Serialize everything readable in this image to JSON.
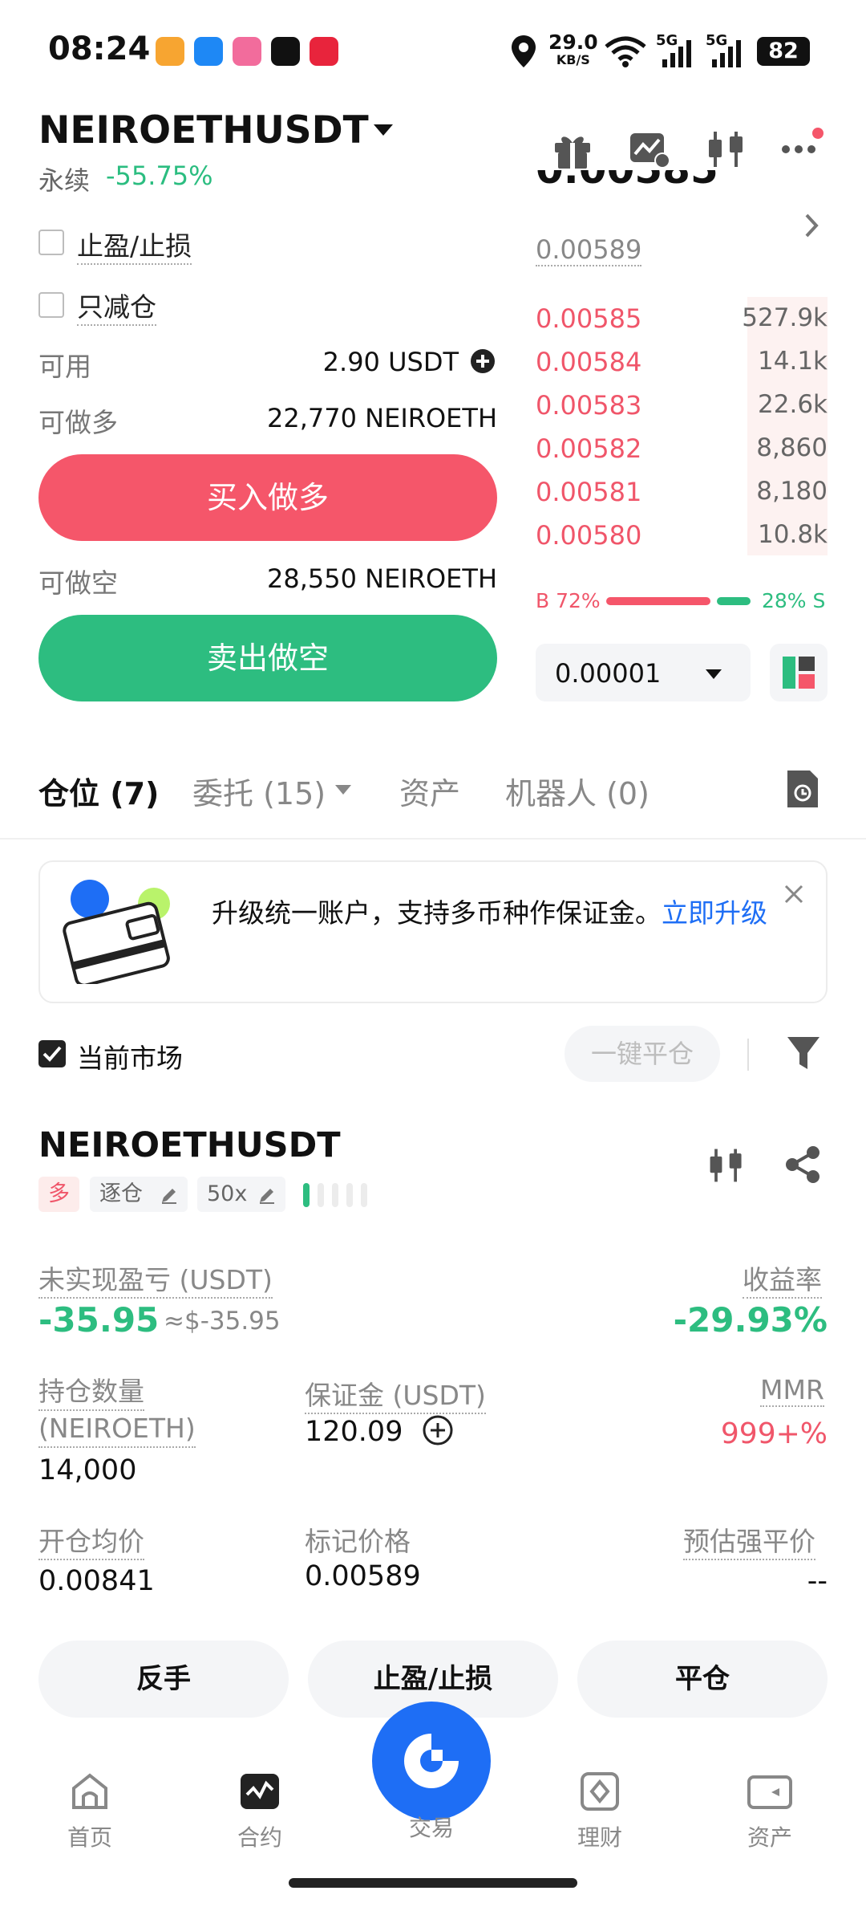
{
  "status_bar": {
    "time": "08:24",
    "net_speed": "29.0",
    "net_unit": "KB/S",
    "signal1": "5G",
    "signal2": "5G",
    "battery": "82"
  },
  "header": {
    "pair": "NEIROETHUSDT",
    "contract_type": "永续",
    "change": "-55.75%",
    "icons": [
      "gift-icon",
      "chart-edit-icon",
      "candlestick-icon",
      "more-icon"
    ]
  },
  "order_form": {
    "tp_sl_label": "止盈/止损",
    "reduce_only_label": "只减仓",
    "available_label": "可用",
    "available_value": "2.90 USDT",
    "long_label": "可做多",
    "long_value": "22,770 NEIROETH",
    "buy_button": "买入做多",
    "short_label": "可做空",
    "short_value": "28,550 NEIROETH",
    "sell_button": "卖出做空"
  },
  "orderbook": {
    "last_price_partial": "0.00585",
    "mark_price": "0.00589",
    "asks": [
      {
        "price": "0.00585",
        "qty": "527.9k"
      },
      {
        "price": "0.00584",
        "qty": "14.1k"
      },
      {
        "price": "0.00583",
        "qty": "22.6k"
      },
      {
        "price": "0.00582",
        "qty": "8,860"
      },
      {
        "price": "0.00581",
        "qty": "8,180"
      },
      {
        "price": "0.00580",
        "qty": "10.8k"
      }
    ],
    "buy_ratio_label": "B 72%",
    "sell_ratio_label": "28% S",
    "buy_ratio": 0.72,
    "tick_size": "0.00001"
  },
  "tabs": {
    "positions": "仓位 (7)",
    "orders": "委托 (15)",
    "assets": "资产",
    "bots": "机器人 (0)"
  },
  "banner": {
    "text": "升级统一账户，支持多币种作保证金。",
    "link": "立即升级"
  },
  "filter": {
    "current_market_label": "当前市场",
    "close_all_button": "一键平仓"
  },
  "position": {
    "pair": "NEIROETHUSDT",
    "side": "多",
    "margin_mode": "逐仓",
    "leverage": "50x",
    "unrealized_label": "未实现盈亏 (USDT)",
    "unrealized_value": "-35.95",
    "unrealized_usd": "≈$-35.95",
    "roi_label": "收益率",
    "roi_value": "-29.93%",
    "size_label_line1": "持仓数量",
    "size_label_line2": "(NEIROETH)",
    "size_value": "14,000",
    "margin_label": "保证金 (USDT)",
    "margin_value": "120.09",
    "mmr_label": "MMR",
    "mmr_value": "999+%",
    "entry_label": "开仓均价",
    "entry_value": "0.00841",
    "mark_label": "标记价格",
    "mark_value": "0.00589",
    "liq_label": "预估强平价",
    "liq_value": "--",
    "reverse_button": "反手",
    "tpsl_button": "止盈/止损",
    "close_button": "平仓"
  },
  "bottom_nav": {
    "home": "首页",
    "futures": "合约",
    "trade": "交易",
    "earn": "理财",
    "assets": "资产"
  },
  "colors": {
    "red": "#f5566a",
    "green": "#2dbd80",
    "blue": "#1e6ef5"
  }
}
